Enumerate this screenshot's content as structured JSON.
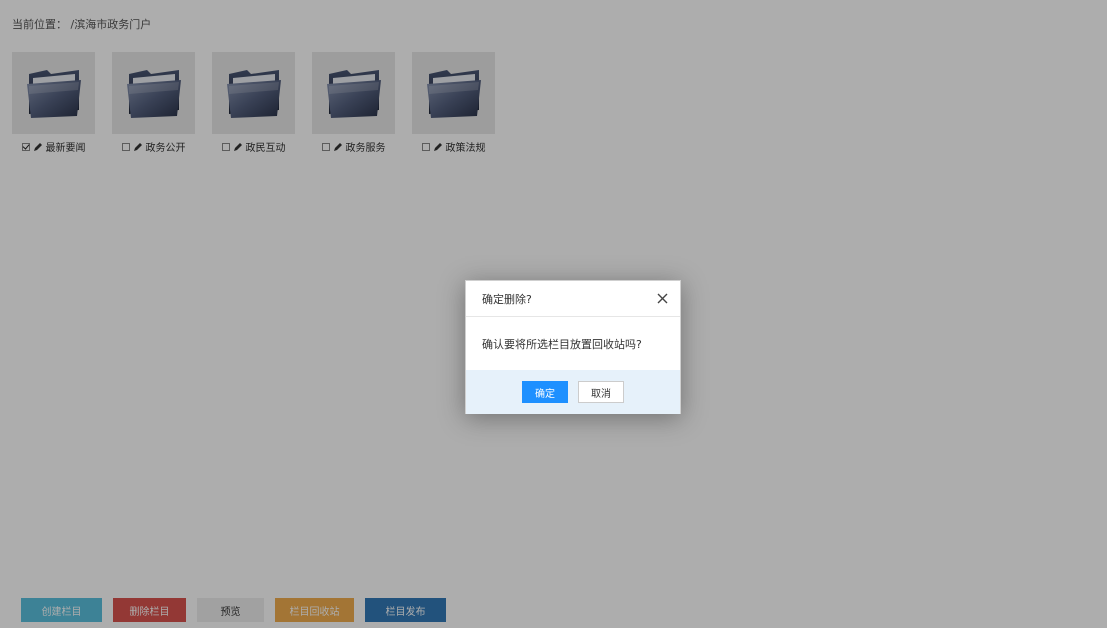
{
  "breadcrumb": {
    "label": "当前位置：",
    "path": "/滨海市政务门户"
  },
  "folders": [
    {
      "label": "最新要闻",
      "checked": true,
      "icon": "folder-icon"
    },
    {
      "label": "政务公开",
      "checked": false,
      "icon": "folder-icon"
    },
    {
      "label": "政民互动",
      "checked": false,
      "icon": "folder-icon"
    },
    {
      "label": "政务服务",
      "checked": false,
      "icon": "folder-icon"
    },
    {
      "label": "政策法规",
      "checked": false,
      "icon": "folder-icon"
    }
  ],
  "toolbar": {
    "create_label": "创建栏目",
    "delete_label": "删除栏目",
    "preview_label": "预览",
    "recycle_label": "栏目回收站",
    "publish_label": "栏目发布"
  },
  "dialog": {
    "title": "确定删除?",
    "message": "确认要将所选栏目放置回收站吗?",
    "ok_label": "确定",
    "cancel_label": "取消",
    "close_icon": "close-icon"
  },
  "colors": {
    "create": "#5bc0de",
    "delete": "#d9534f",
    "recycle": "#f0ad4e",
    "publish": "#337ab7",
    "ok": "#1e90ff",
    "dialog_footer": "#e6f1fa"
  }
}
